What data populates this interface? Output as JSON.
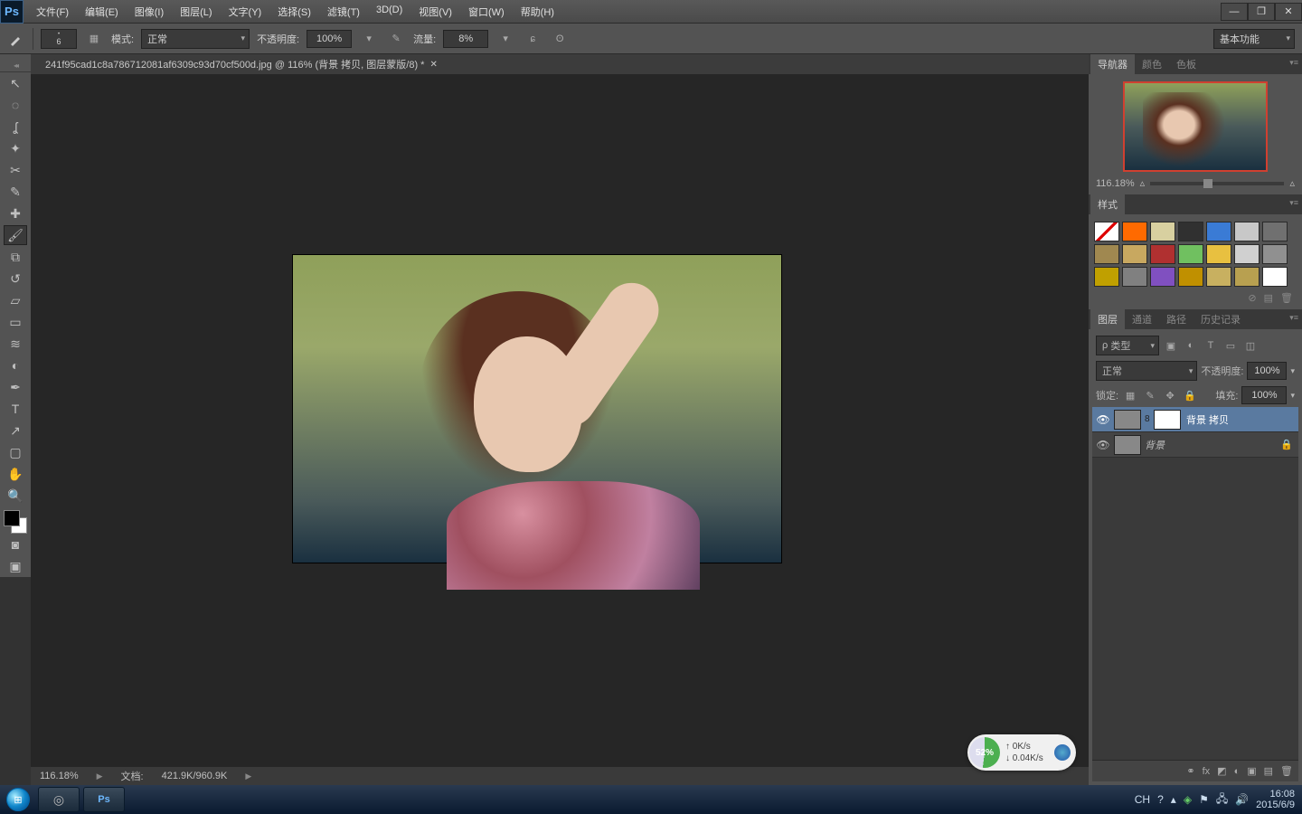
{
  "app": "Ps",
  "menu": [
    "文件(F)",
    "编辑(E)",
    "图像(I)",
    "图层(L)",
    "文字(Y)",
    "选择(S)",
    "滤镜(T)",
    "3D(D)",
    "视图(V)",
    "窗口(W)",
    "帮助(H)"
  ],
  "win_controls": {
    "min": "—",
    "max": "❐",
    "close": "✕"
  },
  "options": {
    "brush_size": "6",
    "mode_label": "模式:",
    "mode_value": "正常",
    "opacity_label": "不透明度:",
    "opacity_value": "100%",
    "flow_label": "流量:",
    "flow_value": "8%",
    "workspace": "基本功能"
  },
  "document": {
    "tab_title": "241f95cad1c8a786712081af6309c93d70cf500d.jpg @ 116% (背景 拷贝, 图层蒙版/8) *"
  },
  "status": {
    "zoom": "116.18%",
    "doc_label": "文档:",
    "doc_value": "421.9K/960.9K"
  },
  "navigator": {
    "tabs": [
      "导航器",
      "颜色",
      "色板"
    ],
    "zoom": "116.18%"
  },
  "styles_panel": {
    "tab": "样式",
    "swatches": [
      "#ffffff",
      "#ff6a00",
      "#d8d0a0",
      "#303030",
      "#3a7bd5",
      "#c8c8c8",
      "#707070",
      "#a08850",
      "#c8a860",
      "#b03030",
      "#70c060",
      "#e8c040",
      "#d0d0d0",
      "#909090",
      "#c0a000",
      "#808080",
      "#8050c0",
      "#c09000",
      "#c8b060",
      "#b8a050",
      "#ffffff"
    ]
  },
  "layers_panel": {
    "tabs": [
      "图层",
      "通道",
      "路径",
      "历史记录"
    ],
    "kind_label": "类型",
    "blend_mode": "正常",
    "opacity_label": "不透明度:",
    "opacity_value": "100%",
    "lock_label": "锁定:",
    "fill_label": "填充:",
    "fill_value": "100%",
    "layers": [
      {
        "name": "背景 拷贝",
        "selected": true,
        "has_mask": true,
        "visible": true,
        "locked": false
      },
      {
        "name": "背景",
        "selected": false,
        "has_mask": false,
        "visible": true,
        "locked": true,
        "italic": true
      }
    ]
  },
  "netwidget": {
    "percent": "52%",
    "up": "↑ 0K/s",
    "down": "↓ 0.04K/s"
  },
  "taskbar": {
    "ime": "CH",
    "time": "16:08",
    "date": "2015/6/9"
  },
  "tools": [
    "move",
    "marquee",
    "lasso",
    "wand",
    "crop",
    "eyedropper",
    "heal",
    "brush",
    "stamp",
    "history-brush",
    "eraser",
    "gradient",
    "blur",
    "dodge",
    "pen",
    "type",
    "path-select",
    "shape",
    "hand",
    "zoom"
  ],
  "tool_glyphs": {
    "move": "↖",
    "marquee": "◌",
    "lasso": "ʆ",
    "wand": "✦",
    "crop": "✂",
    "eyedropper": "✎",
    "heal": "✚",
    "brush": "🖌",
    "stamp": "⧉",
    "history-brush": "↺",
    "eraser": "▱",
    "gradient": "▭",
    "blur": "≋",
    "dodge": "◐",
    "pen": "✒",
    "type": "T",
    "path-select": "↗",
    "shape": "▢",
    "hand": "✋",
    "zoom": "🔍"
  },
  "icons": {
    "kind_filter": "ρ",
    "image_filter": "▣",
    "adjust_filter": "◐",
    "type_filter": "T",
    "shape_filter": "▭",
    "smart_filter": "◫",
    "lock_transparent": "▦",
    "lock_paint": "✎",
    "lock_move": "✥",
    "lock_all": "🔒",
    "link": "⚭",
    "fx": "fx",
    "mask": "◩",
    "adjustment": "◐",
    "group": "▣",
    "new": "▤",
    "trash": "🗑",
    "eye": "👁",
    "search": "🔍"
  }
}
